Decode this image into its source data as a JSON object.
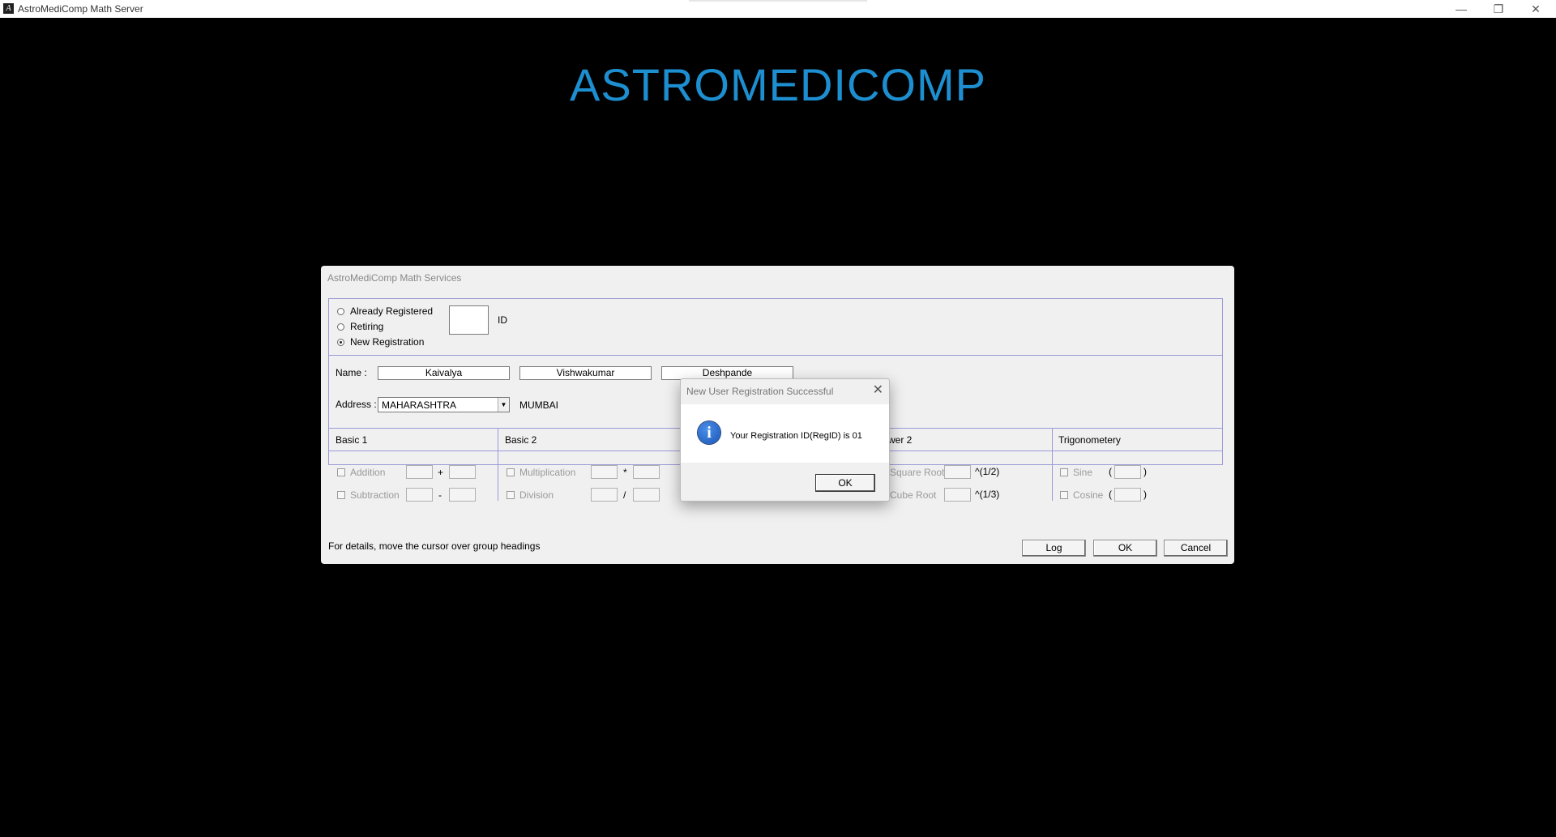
{
  "window": {
    "title": "AstroMediComp Math Server",
    "minimize": "—",
    "restore": "❐",
    "close": "✕"
  },
  "logo_text": "ASTROMEDICOMP",
  "dialog": {
    "title": "AstroMediComp Math Services",
    "registration": {
      "options": [
        "Already Registered",
        "Retiring",
        "New Registration"
      ],
      "selected": "New Registration",
      "id_label": "ID",
      "id_value": ""
    },
    "name": {
      "label": "Name :",
      "first": "Kaivalya",
      "middle": "Vishwakumar",
      "last": "Deshpande"
    },
    "address": {
      "label": "Address :",
      "state": "MAHARASHTRA",
      "city": "MUMBAI"
    },
    "groups": [
      {
        "title": "Basic 1",
        "items": [
          {
            "label": "Addition",
            "op": "+"
          },
          {
            "label": "Subtraction",
            "op": "-"
          }
        ]
      },
      {
        "title": "Basic 2",
        "items": [
          {
            "label": "Multiplication",
            "op": "*"
          },
          {
            "label": "Division",
            "op": "/"
          }
        ]
      },
      {
        "title": "wer 2",
        "items": [
          {
            "label": "Square Root",
            "op": "^(1/2)"
          },
          {
            "label": "Cube Root",
            "op": "^(1/3)"
          }
        ]
      },
      {
        "title": "Trigonometery",
        "items": [
          {
            "label": "Sine",
            "open": "(",
            "close": ")"
          },
          {
            "label": "Cosine",
            "open": "(",
            "close": ")"
          }
        ]
      }
    ],
    "hint": "For details, move the cursor over group headings",
    "buttons": {
      "log": "Log",
      "ok": "OK",
      "cancel": "Cancel"
    }
  },
  "message_box": {
    "title": "New User Registration Successful",
    "close": "✕",
    "icon": "info-icon",
    "icon_glyph": "i",
    "text": "Your Registration ID(RegID) is 01",
    "ok": "OK"
  },
  "colors": {
    "logo": "#1d8fd0",
    "group_border": "#9a9ad8",
    "background": "#000000"
  }
}
